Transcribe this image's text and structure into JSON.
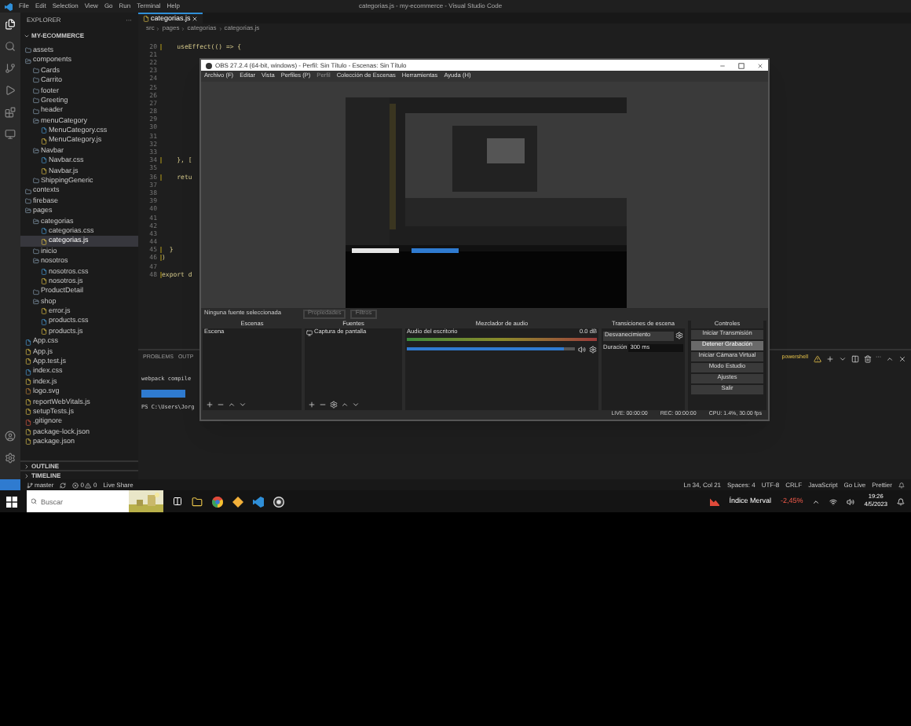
{
  "title_bar": {
    "menu": [
      "File",
      "Edit",
      "Selection",
      "View",
      "Go",
      "Run",
      "Terminal",
      "Help"
    ],
    "title": "categorias.js - my-ecommerce - Visual Studio Code"
  },
  "explorer": {
    "header": "EXPLORER",
    "more": "···",
    "project": "MY-ECOMMERCE",
    "tree": [
      {
        "name": "assets",
        "kind": "folder",
        "expanded": false,
        "selected": false
      },
      {
        "name": "components",
        "kind": "folder",
        "expanded": true,
        "selected": false,
        "children": [
          {
            "name": "Cards",
            "kind": "folder",
            "expanded": false,
            "selected": false
          },
          {
            "name": "Carrito",
            "kind": "folder",
            "expanded": false,
            "selected": false
          },
          {
            "name": "footer",
            "kind": "folder",
            "expanded": false,
            "selected": false
          },
          {
            "name": "Greeting",
            "kind": "folder",
            "expanded": false,
            "selected": false
          },
          {
            "name": "header",
            "kind": "folder",
            "expanded": false,
            "selected": false
          },
          {
            "name": "menuCategory",
            "kind": "folder",
            "expanded": true,
            "selected": false,
            "children": [
              {
                "name": "MenuCategory.css",
                "kind": "css",
                "selected": false
              },
              {
                "name": "MenuCategory.js",
                "kind": "js",
                "selected": false
              }
            ]
          },
          {
            "name": "Navbar",
            "kind": "folder",
            "expanded": true,
            "selected": false,
            "children": [
              {
                "name": "Navbar.css",
                "kind": "css",
                "selected": false
              },
              {
                "name": "Navbar.js",
                "kind": "js",
                "selected": false
              }
            ]
          },
          {
            "name": "ShippingGeneric",
            "kind": "folder",
            "expanded": false,
            "selected": false
          }
        ]
      },
      {
        "name": "contexts",
        "kind": "folder",
        "expanded": false,
        "selected": false
      },
      {
        "name": "firebase",
        "kind": "folder",
        "expanded": false,
        "selected": false
      },
      {
        "name": "pages",
        "kind": "folder",
        "expanded": true,
        "selected": false,
        "children": [
          {
            "name": "categorias",
            "kind": "folder",
            "expanded": true,
            "selected": false,
            "children": [
              {
                "name": "categorias.css",
                "kind": "css",
                "selected": false
              },
              {
                "name": "categorias.js",
                "kind": "js",
                "selected": true
              }
            ]
          },
          {
            "name": "inicio",
            "kind": "folder",
            "expanded": false,
            "selected": false
          },
          {
            "name": "nosotros",
            "kind": "folder",
            "expanded": true,
            "selected": false,
            "children": [
              {
                "name": "nosotros.css",
                "kind": "css",
                "selected": false
              },
              {
                "name": "nosotros.js",
                "kind": "js",
                "selected": false
              }
            ]
          },
          {
            "name": "ProductDetail",
            "kind": "folder",
            "expanded": false,
            "selected": false
          },
          {
            "name": "shop",
            "kind": "folder",
            "expanded": true,
            "selected": false,
            "children": [
              {
                "name": "error.js",
                "kind": "js",
                "selected": false
              },
              {
                "name": "products.css",
                "kind": "css",
                "selected": false
              },
              {
                "name": "products.js",
                "kind": "js",
                "selected": false
              }
            ]
          }
        ]
      },
      {
        "name": "App.css",
        "kind": "css",
        "selected": false
      },
      {
        "name": "App.js",
        "kind": "js",
        "selected": false
      },
      {
        "name": "App.test.js",
        "kind": "js",
        "selected": false
      },
      {
        "name": "index.css",
        "kind": "css",
        "selected": false
      },
      {
        "name": "index.js",
        "kind": "js",
        "selected": false
      },
      {
        "name": "logo.svg",
        "kind": "svg",
        "selected": false
      },
      {
        "name": "reportWebVitals.js",
        "kind": "js",
        "selected": false
      },
      {
        "name": "setupTests.js",
        "kind": "js",
        "selected": false
      },
      {
        "name": ".gitignore",
        "kind": "git",
        "selected": false
      },
      {
        "name": "package-lock.json",
        "kind": "json",
        "selected": false
      },
      {
        "name": "package.json",
        "kind": "json",
        "selected": false
      }
    ],
    "sections": [
      "OUTLINE",
      "TIMELINE"
    ]
  },
  "editor": {
    "tab": "categorias.js",
    "breadcrumb": [
      "src",
      "pages",
      "categorias",
      "categorias.js"
    ],
    "lines": [
      {
        "number": "20",
        "text": "    useEffect(() => {"
      },
      {
        "number": "21"
      },
      {
        "number": "22"
      },
      {
        "number": "23"
      },
      {
        "number": "24"
      },
      {
        "number": "25"
      },
      {
        "number": "26"
      },
      {
        "number": "27"
      },
      {
        "number": "28"
      },
      {
        "number": "29"
      },
      {
        "number": "30"
      },
      {
        "number": "31"
      },
      {
        "number": "32"
      },
      {
        "number": "33"
      },
      {
        "number": "34",
        "text": "    }, ["
      },
      {
        "number": "35"
      },
      {
        "number": "36",
        "text": "    retu"
      },
      {
        "number": "37"
      },
      {
        "number": "38"
      },
      {
        "number": "39"
      },
      {
        "number": "40"
      },
      {
        "number": "41"
      },
      {
        "number": "42"
      },
      {
        "number": "43"
      },
      {
        "number": "44"
      },
      {
        "number": "45",
        "text": "  }"
      },
      {
        "number": "46",
        "text": ")"
      },
      {
        "number": "47"
      },
      {
        "number": "48",
        "text": "export d"
      }
    ]
  },
  "panel": {
    "tabs": [
      {
        "label": "PROBLEMS",
        "selected": false
      },
      {
        "label": "OUTP",
        "selected": false
      }
    ],
    "terminal_label": "powershell",
    "lines": [
      "webpack compile",
      "PS C:\\Users\\Jorg"
    ]
  },
  "obs": {
    "title": "OBS 27.2.4 (64-bit, windows) - Perfil: Sin Título - Escenas: Sin Título",
    "menu": [
      {
        "label": "Archivo (F)",
        "disabled": false
      },
      {
        "label": "Editar",
        "disabled": false
      },
      {
        "label": "Vista",
        "disabled": false
      },
      {
        "label": "Perfiles (P)",
        "disabled": false
      },
      {
        "label": "Perfil",
        "disabled": true
      },
      {
        "label": "Colección de Escenas",
        "disabled": false
      },
      {
        "label": "Herramientas",
        "disabled": false
      },
      {
        "label": "Ayuda (H)",
        "disabled": false
      }
    ],
    "source_bar": {
      "text": "Ninguna fuente seleccionada",
      "buttons": [
        {
          "label": "Propiedades",
          "disabled": true
        },
        {
          "label": "Filtros",
          "disabled": true
        }
      ]
    },
    "scenes": {
      "title": "Escenas",
      "items": [
        {
          "label": "Escena",
          "selected": false
        }
      ]
    },
    "sources": {
      "title": "Fuentes",
      "items": [
        {
          "label": "Captura de pantalla",
          "selected": false
        }
      ]
    },
    "mixer": {
      "title": "Mezclador de audio",
      "channel": "Audio del escritorio",
      "reading": "0.0 dB",
      "level": 0.93
    },
    "transitions": {
      "title": "Transiciones de escena",
      "type": "Desvanecimiento",
      "duration_label": "Duración",
      "duration": "300 ms"
    },
    "controls": {
      "title": "Controles",
      "buttons": [
        {
          "label": "Iniciar Transmisión",
          "hovered": false
        },
        {
          "label": "Detener Grabación",
          "hovered": true
        },
        {
          "label": "Iniciar Cámara Virtual",
          "hovered": false
        },
        {
          "label": "Modo Estudio",
          "hovered": false
        },
        {
          "label": "Ajustes",
          "hovered": false
        },
        {
          "label": "Salir",
          "hovered": false
        }
      ]
    },
    "status": [
      "LIVE: 00:00:00",
      "REC: 00:00:00",
      "CPU: 1.4%, 30.00 fps"
    ]
  },
  "status_bar": {
    "branch": "master",
    "problems": "0",
    "warnings": "0",
    "live_share": "Live Share",
    "right": [
      "Ln 34, Col 21",
      "Spaces: 4",
      "UTF-8",
      "CRLF",
      "JavaScript",
      "Go Live",
      "Prettier"
    ]
  },
  "taskbar": {
    "search_placeholder": "Buscar",
    "stock": "Índice Merval",
    "change": "-2,45%",
    "time": "19:26",
    "date": "4/5/2023"
  }
}
